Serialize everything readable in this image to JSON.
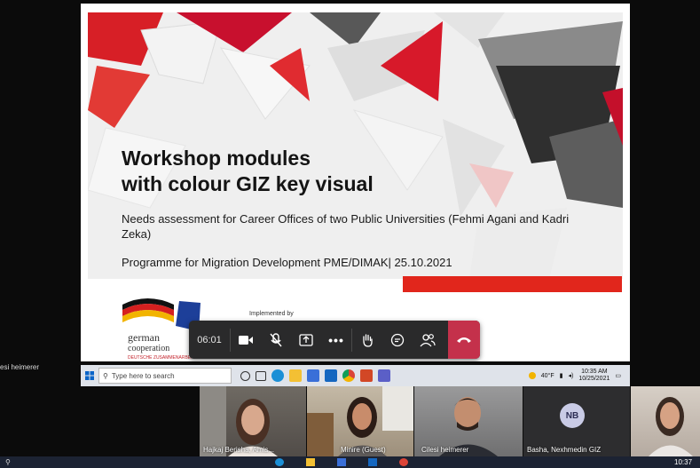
{
  "slide": {
    "title_line1": "Workshop modules",
    "title_line2": "with colour GIZ key visual",
    "subtitle": "Needs assessment for Career Offices of two Public Universities (Fehmi Agani and Kadri Zeka)",
    "programme": "Programme for Migration Development PME/DIMAK| 25.10.2021",
    "implemented_by": "Implemented by",
    "logo_text1": "german",
    "logo_text2": "cooperation",
    "logo_text3": "DEUTSCHE ZUSAMMENARBEIT"
  },
  "controls": {
    "timer": "06:01"
  },
  "presenter_caption": "esi heimerer",
  "taskbar": {
    "search_placeholder": "Type here to search",
    "weather": "40°F",
    "time": "10:35 AM",
    "date": "10/25/2021"
  },
  "participants": [
    {
      "name": "Hajkaj Berisha, Amis..."
    },
    {
      "name": "Minire (Guest)"
    },
    {
      "name": "Cilesi heimerer"
    },
    {
      "name": "Basha, Nexhmedin GIZ",
      "initials": "NB"
    },
    {
      "name": ""
    }
  ],
  "bottom_taskbar": {
    "time": "10:37"
  },
  "colors": {
    "giz_red": "#e1261c",
    "hangup": "#c4314b",
    "avatar_bg": "#c9cbe6"
  }
}
